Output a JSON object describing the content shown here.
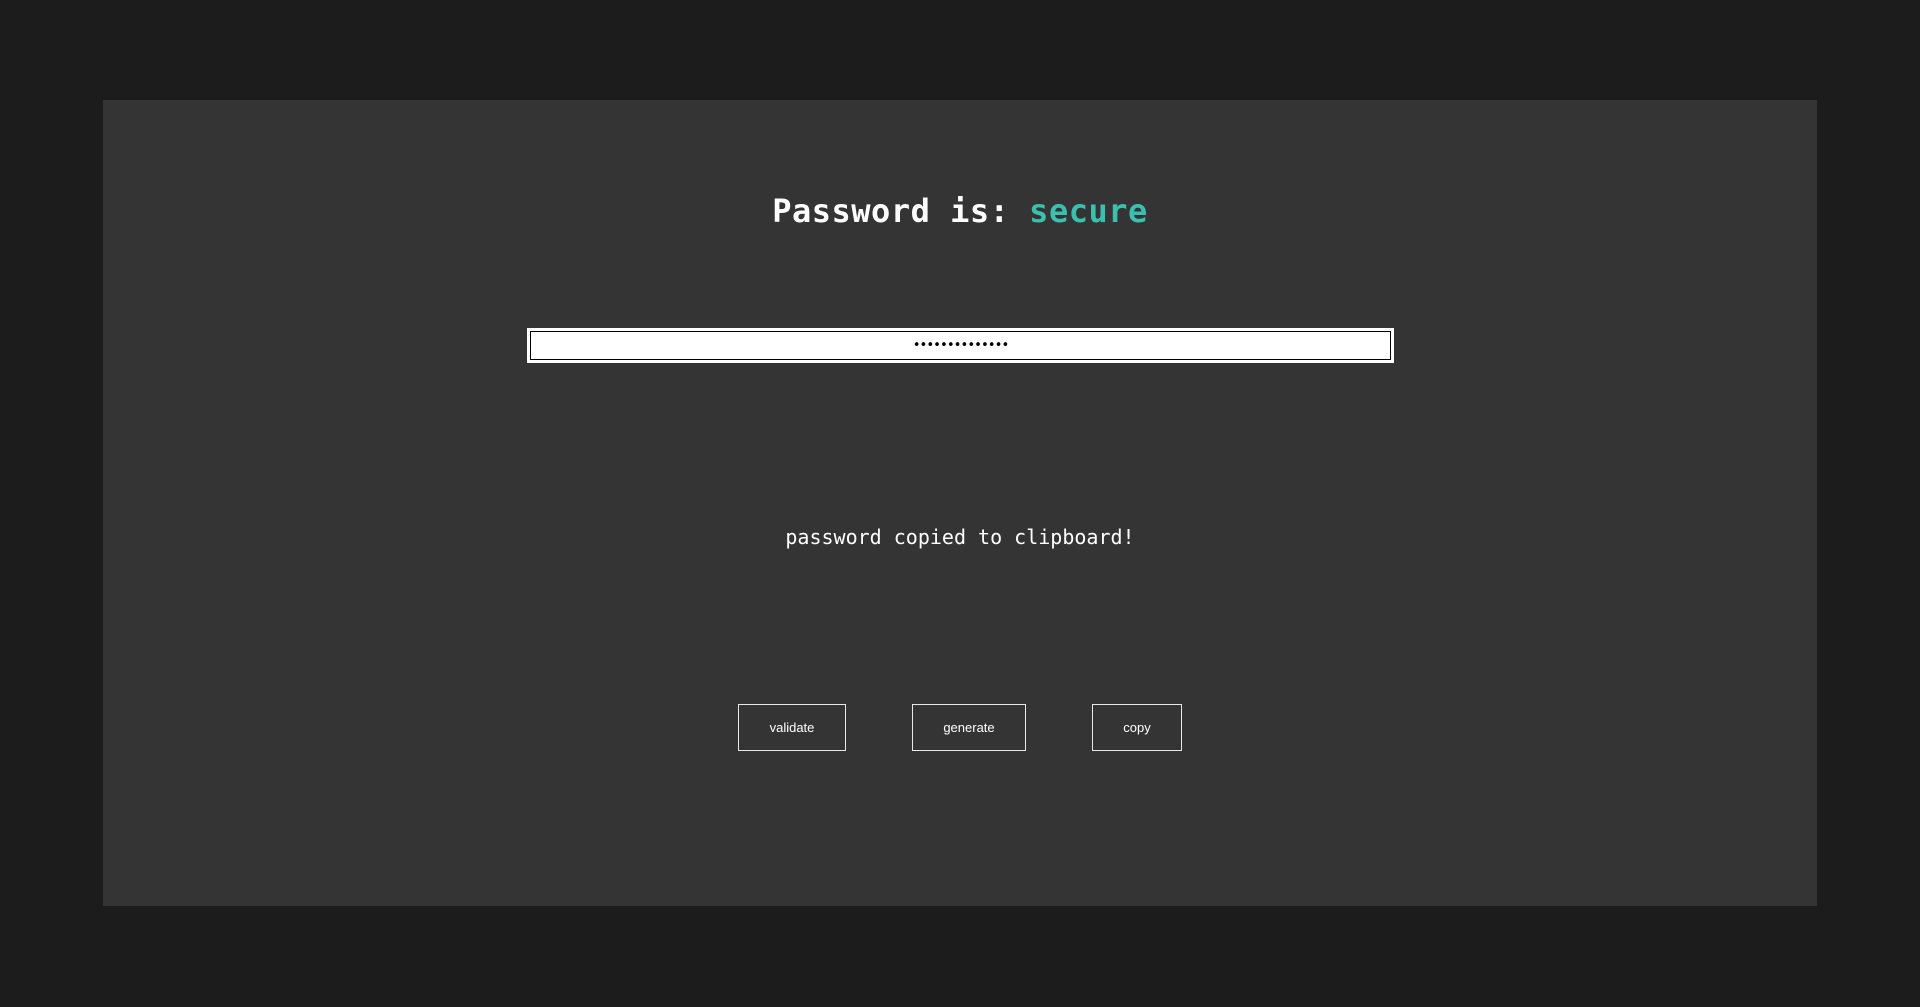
{
  "header": {
    "prefix": "Password is: ",
    "status": "secure",
    "status_color": "#3bbfae"
  },
  "password_field": {
    "value": "••••••••••••••",
    "input_type": "password"
  },
  "message": "password copied to clipboard!",
  "buttons": {
    "validate": "validate",
    "generate": "generate",
    "copy": "copy"
  },
  "colors": {
    "page_background": "#1c1c1c",
    "card_background": "#343434",
    "accent": "#3bbfae"
  }
}
